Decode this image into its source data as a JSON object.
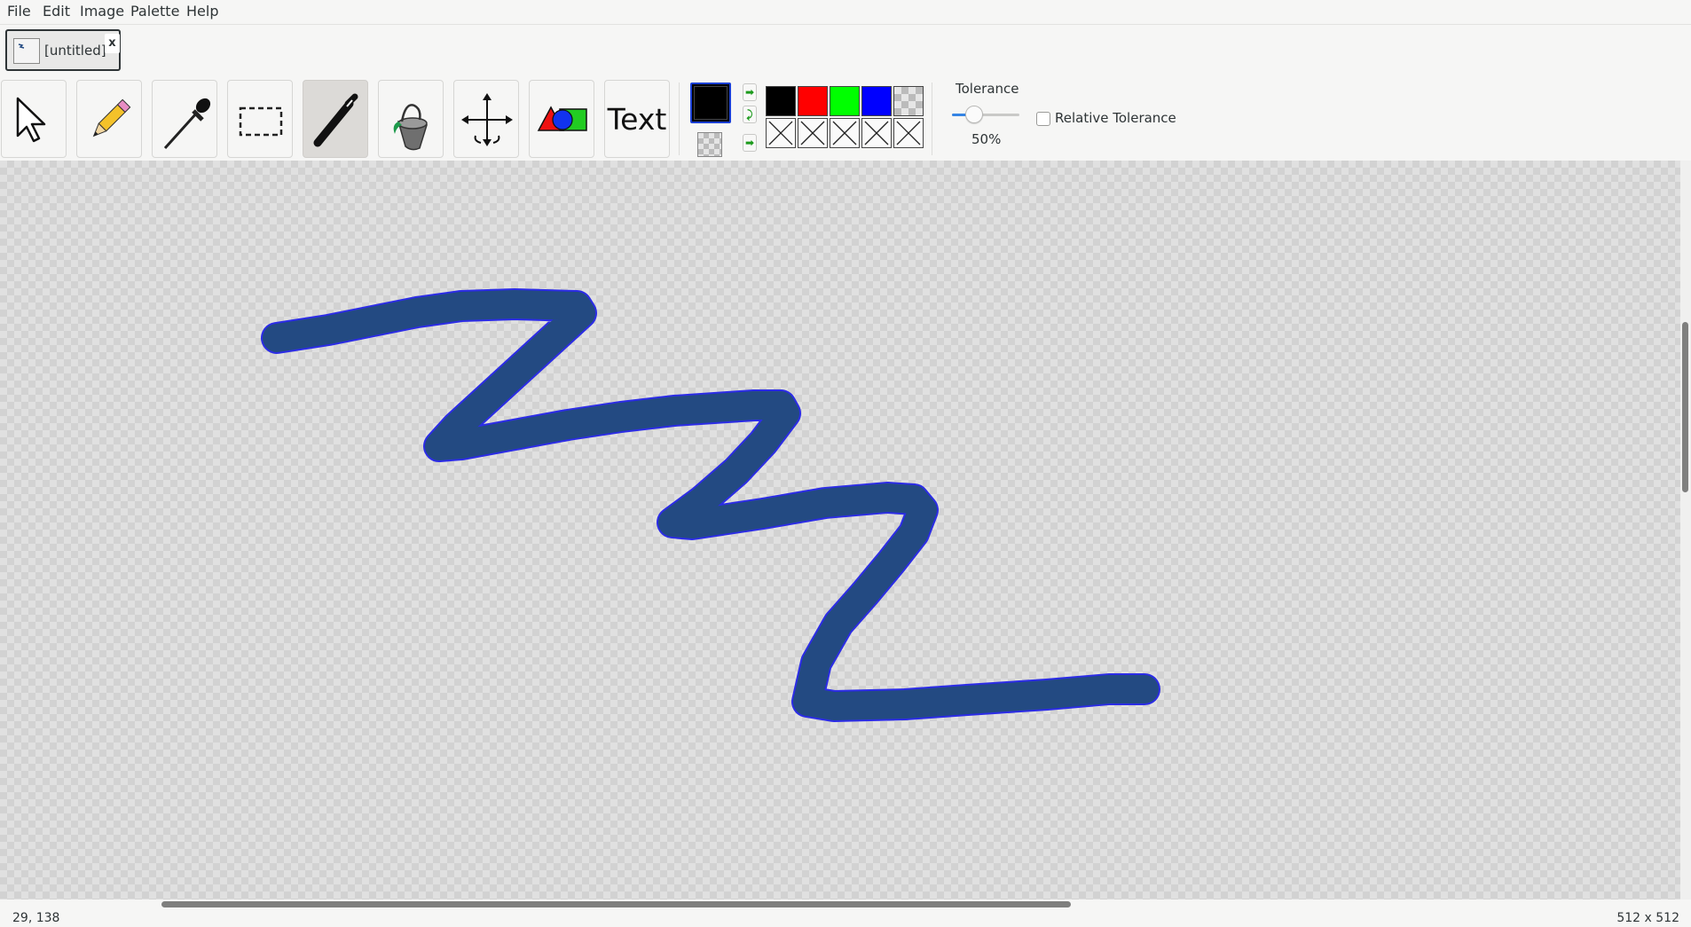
{
  "menu": {
    "file": "File",
    "edit": "Edit",
    "image": "Image",
    "palette": "Palette",
    "help": "Help"
  },
  "document_tab": {
    "title": "[untitled]",
    "close_label": "x"
  },
  "tools": {
    "text_label": "Text",
    "active_tool": "brush"
  },
  "colors": {
    "primary": "#000000",
    "secondary": "transparent",
    "palette": [
      "#000000",
      "#ff0000",
      "#00ff00",
      "#0000ff",
      "transparent",
      "empty",
      "empty",
      "empty",
      "empty",
      "empty"
    ],
    "stroke_fill": "#234a82",
    "stroke_edge": "#2c2ce6"
  },
  "tolerance": {
    "label": "Tolerance",
    "value": 0.5,
    "value_label": "50%",
    "relative_label": "Relative Tolerance",
    "relative_checked": false
  },
  "status": {
    "cursor_position": "29, 138",
    "image_size": "512 x 512"
  }
}
